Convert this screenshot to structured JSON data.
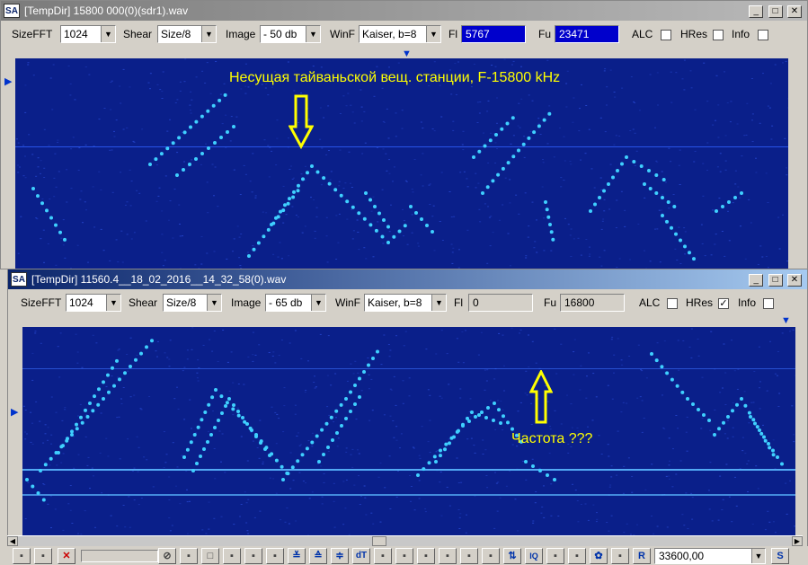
{
  "app_icon": "SA",
  "window1": {
    "title": "[TempDir] 15800 000(0)(sdr1).wav",
    "sizefft_label": "SizeFFT",
    "sizefft_value": "1024",
    "shear_label": "Shear",
    "shear_value": "Size/8",
    "image_label": "Image",
    "image_value": "- 50 db",
    "winf_label": "WinF",
    "winf_value": "Kaiser, b=8",
    "fl_label": "Fl",
    "fl_value": "5767",
    "fu_label": "Fu",
    "fu_value": "23471",
    "alc_label": "ALC",
    "hres_label": "HRes",
    "info_label": "Info",
    "annotation": "Несущая тайваньской вещ. станции, F-15800 kHz"
  },
  "window2": {
    "title": "[TempDir] 11560.4__18_02_2016__14_32_58(0).wav",
    "sizefft_label": "SizeFFT",
    "sizefft_value": "1024",
    "shear_label": "Shear",
    "shear_value": "Size/8",
    "image_label": "Image",
    "image_value": "- 65 db",
    "winf_label": "WinF",
    "winf_value": "Kaiser, b=8",
    "fl_label": "Fl",
    "fl_value": "0",
    "fu_label": "Fu",
    "fu_value": "16800",
    "alc_label": "ALC",
    "hres_label": "HRes",
    "hres_checked": "✓",
    "info_label": "Info",
    "annotation": "Частота ???"
  },
  "bottom_toolbar": {
    "dt_label": "dT",
    "iq_label": "IQ",
    "r_label": "R",
    "s_label": "S",
    "frequency_value": "33600,00"
  },
  "colors": {
    "spectrum_background": "#0a1f8a",
    "trace": "#3fd0ff",
    "annotation": "#ffff00",
    "active_field": "#0000cc"
  }
}
